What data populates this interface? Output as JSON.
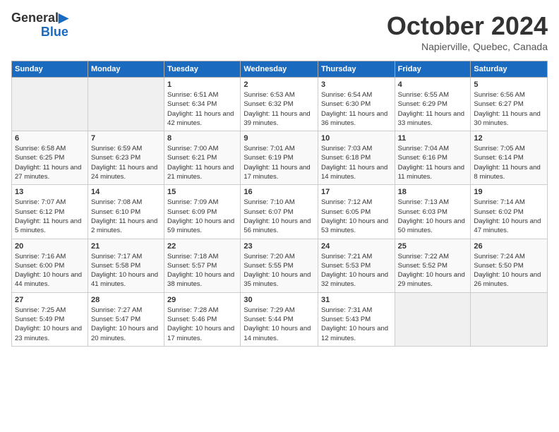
{
  "logo": {
    "line1": "General",
    "line2": "Blue"
  },
  "title": "October 2024",
  "subtitle": "Napierville, Quebec, Canada",
  "days_of_week": [
    "Sunday",
    "Monday",
    "Tuesday",
    "Wednesday",
    "Thursday",
    "Friday",
    "Saturday"
  ],
  "weeks": [
    [
      {
        "num": "",
        "info": ""
      },
      {
        "num": "",
        "info": ""
      },
      {
        "num": "1",
        "info": "Sunrise: 6:51 AM\nSunset: 6:34 PM\nDaylight: 11 hours and 42 minutes."
      },
      {
        "num": "2",
        "info": "Sunrise: 6:53 AM\nSunset: 6:32 PM\nDaylight: 11 hours and 39 minutes."
      },
      {
        "num": "3",
        "info": "Sunrise: 6:54 AM\nSunset: 6:30 PM\nDaylight: 11 hours and 36 minutes."
      },
      {
        "num": "4",
        "info": "Sunrise: 6:55 AM\nSunset: 6:29 PM\nDaylight: 11 hours and 33 minutes."
      },
      {
        "num": "5",
        "info": "Sunrise: 6:56 AM\nSunset: 6:27 PM\nDaylight: 11 hours and 30 minutes."
      }
    ],
    [
      {
        "num": "6",
        "info": "Sunrise: 6:58 AM\nSunset: 6:25 PM\nDaylight: 11 hours and 27 minutes."
      },
      {
        "num": "7",
        "info": "Sunrise: 6:59 AM\nSunset: 6:23 PM\nDaylight: 11 hours and 24 minutes."
      },
      {
        "num": "8",
        "info": "Sunrise: 7:00 AM\nSunset: 6:21 PM\nDaylight: 11 hours and 21 minutes."
      },
      {
        "num": "9",
        "info": "Sunrise: 7:01 AM\nSunset: 6:19 PM\nDaylight: 11 hours and 17 minutes."
      },
      {
        "num": "10",
        "info": "Sunrise: 7:03 AM\nSunset: 6:18 PM\nDaylight: 11 hours and 14 minutes."
      },
      {
        "num": "11",
        "info": "Sunrise: 7:04 AM\nSunset: 6:16 PM\nDaylight: 11 hours and 11 minutes."
      },
      {
        "num": "12",
        "info": "Sunrise: 7:05 AM\nSunset: 6:14 PM\nDaylight: 11 hours and 8 minutes."
      }
    ],
    [
      {
        "num": "13",
        "info": "Sunrise: 7:07 AM\nSunset: 6:12 PM\nDaylight: 11 hours and 5 minutes."
      },
      {
        "num": "14",
        "info": "Sunrise: 7:08 AM\nSunset: 6:10 PM\nDaylight: 11 hours and 2 minutes."
      },
      {
        "num": "15",
        "info": "Sunrise: 7:09 AM\nSunset: 6:09 PM\nDaylight: 10 hours and 59 minutes."
      },
      {
        "num": "16",
        "info": "Sunrise: 7:10 AM\nSunset: 6:07 PM\nDaylight: 10 hours and 56 minutes."
      },
      {
        "num": "17",
        "info": "Sunrise: 7:12 AM\nSunset: 6:05 PM\nDaylight: 10 hours and 53 minutes."
      },
      {
        "num": "18",
        "info": "Sunrise: 7:13 AM\nSunset: 6:03 PM\nDaylight: 10 hours and 50 minutes."
      },
      {
        "num": "19",
        "info": "Sunrise: 7:14 AM\nSunset: 6:02 PM\nDaylight: 10 hours and 47 minutes."
      }
    ],
    [
      {
        "num": "20",
        "info": "Sunrise: 7:16 AM\nSunset: 6:00 PM\nDaylight: 10 hours and 44 minutes."
      },
      {
        "num": "21",
        "info": "Sunrise: 7:17 AM\nSunset: 5:58 PM\nDaylight: 10 hours and 41 minutes."
      },
      {
        "num": "22",
        "info": "Sunrise: 7:18 AM\nSunset: 5:57 PM\nDaylight: 10 hours and 38 minutes."
      },
      {
        "num": "23",
        "info": "Sunrise: 7:20 AM\nSunset: 5:55 PM\nDaylight: 10 hours and 35 minutes."
      },
      {
        "num": "24",
        "info": "Sunrise: 7:21 AM\nSunset: 5:53 PM\nDaylight: 10 hours and 32 minutes."
      },
      {
        "num": "25",
        "info": "Sunrise: 7:22 AM\nSunset: 5:52 PM\nDaylight: 10 hours and 29 minutes."
      },
      {
        "num": "26",
        "info": "Sunrise: 7:24 AM\nSunset: 5:50 PM\nDaylight: 10 hours and 26 minutes."
      }
    ],
    [
      {
        "num": "27",
        "info": "Sunrise: 7:25 AM\nSunset: 5:49 PM\nDaylight: 10 hours and 23 minutes."
      },
      {
        "num": "28",
        "info": "Sunrise: 7:27 AM\nSunset: 5:47 PM\nDaylight: 10 hours and 20 minutes."
      },
      {
        "num": "29",
        "info": "Sunrise: 7:28 AM\nSunset: 5:46 PM\nDaylight: 10 hours and 17 minutes."
      },
      {
        "num": "30",
        "info": "Sunrise: 7:29 AM\nSunset: 5:44 PM\nDaylight: 10 hours and 14 minutes."
      },
      {
        "num": "31",
        "info": "Sunrise: 7:31 AM\nSunset: 5:43 PM\nDaylight: 10 hours and 12 minutes."
      },
      {
        "num": "",
        "info": ""
      },
      {
        "num": "",
        "info": ""
      }
    ]
  ]
}
